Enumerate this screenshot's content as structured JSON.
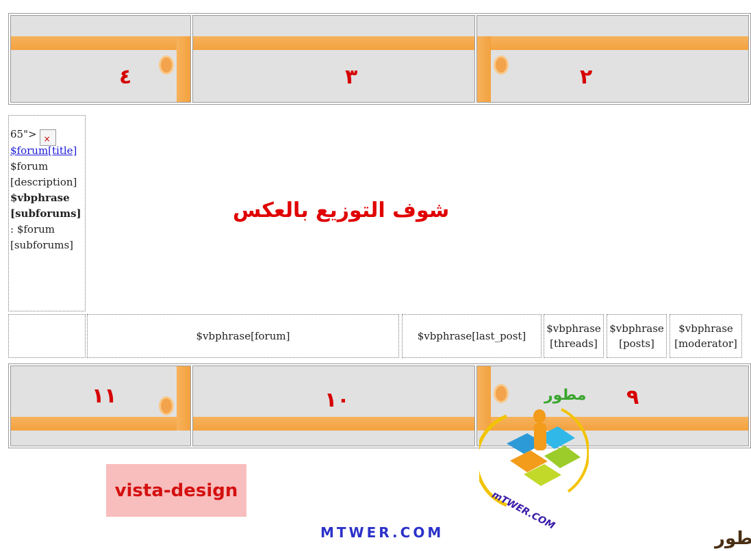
{
  "top_strip": {
    "cells": [
      "٤",
      "٣",
      "٢"
    ]
  },
  "bottom_strip": {
    "cells": [
      "١١",
      "١٠",
      "٩"
    ]
  },
  "left_column": {
    "prefix": "65\">",
    "broken_image_glyph": "×",
    "forum_title_link": "$forum[title]",
    "forum_word": "$forum",
    "description": "[description]",
    "vbphrase": "$vbphrase",
    "subforums_bold": "[subforums]",
    "forum_subforums_line1": ": $forum",
    "forum_subforums_line2": "[subforums]"
  },
  "main_note": "شوف التوزيع بالعكس",
  "header_row": {
    "forum": "$vbphrase[forum]",
    "last_post": "$vbphrase[last_post]",
    "threads_1": "$vbphrase",
    "threads_2": "[threads]",
    "posts_1": "$vbphrase",
    "posts_2": "[posts]",
    "moderator_1": "$vbphrase",
    "moderator_2": "[moderator]"
  },
  "vista_label": "vista-design",
  "footer_site": "MTWER.COM",
  "logo_ring_text": "mTWER.COM",
  "logo_arabic": "مطور",
  "corner_logo": "مطور",
  "colors": {
    "accent_orange": "#f4a23f",
    "number_red": "#d60000",
    "note_red": "#e00000",
    "link_blue": "#1a1ad6",
    "vista_bg": "#f8bdbd",
    "site_blue": "#2b32c8"
  }
}
